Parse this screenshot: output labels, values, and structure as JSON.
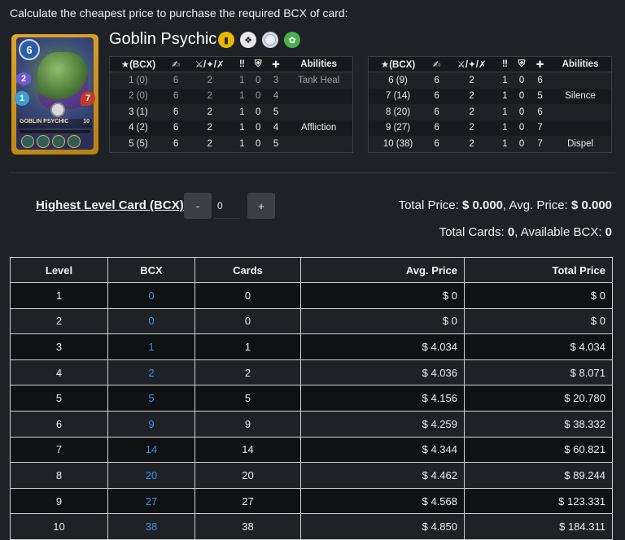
{
  "instruction": "Calculate the cheapest price to purchase the required BCX of card:",
  "card": {
    "name": "Goblin Psychic",
    "art_name": "GOBLIN PSYCHIC",
    "art_mana": "6",
    "art_level": "2",
    "art_speed": "1",
    "art_health": "7",
    "art_level_small": "10",
    "icons": [
      "rarity-icon",
      "edition-icon",
      "type-icon",
      "element-icon"
    ]
  },
  "stat_headers": {
    "level": "★(BCX)",
    "mana_icon": "mana-icon",
    "attack_icon": "attack-icon",
    "speed_icon": "speed-icon",
    "armor_icon": "armor-icon",
    "health_icon": "health-icon",
    "abilities": "Abilities"
  },
  "stats_left": [
    {
      "lvl": "1 (0)",
      "mana": "6",
      "atk": "2",
      "spd": "1",
      "arm": "0",
      "hp": "3",
      "abil": "Tank Heal",
      "dim": true
    },
    {
      "lvl": "2 (0)",
      "mana": "6",
      "atk": "2",
      "spd": "1",
      "arm": "0",
      "hp": "4",
      "abil": "",
      "dim": true
    },
    {
      "lvl": "3 (1)",
      "mana": "6",
      "atk": "2",
      "spd": "1",
      "arm": "0",
      "hp": "5",
      "abil": "",
      "dim": false
    },
    {
      "lvl": "4 (2)",
      "mana": "6",
      "atk": "2",
      "spd": "1",
      "arm": "0",
      "hp": "4",
      "abil": "Affliction",
      "dim": false
    },
    {
      "lvl": "5 (5)",
      "mana": "6",
      "atk": "2",
      "spd": "1",
      "arm": "0",
      "hp": "5",
      "abil": "",
      "dim": false
    }
  ],
  "stats_right": [
    {
      "lvl": "6 (9)",
      "mana": "6",
      "atk": "2",
      "spd": "1",
      "arm": "0",
      "hp": "6",
      "abil": ""
    },
    {
      "lvl": "7 (14)",
      "mana": "6",
      "atk": "2",
      "spd": "1",
      "arm": "0",
      "hp": "5",
      "abil": "Silence"
    },
    {
      "lvl": "8 (20)",
      "mana": "6",
      "atk": "2",
      "spd": "1",
      "arm": "0",
      "hp": "6",
      "abil": ""
    },
    {
      "lvl": "9 (27)",
      "mana": "6",
      "atk": "2",
      "spd": "1",
      "arm": "0",
      "hp": "7",
      "abil": ""
    },
    {
      "lvl": "10 (38)",
      "mana": "6",
      "atk": "2",
      "spd": "1",
      "arm": "0",
      "hp": "7",
      "abil": "Dispel"
    }
  ],
  "controls": {
    "label": "Highest Level Card (BCX)",
    "minus": "-",
    "plus": "+",
    "value": "0"
  },
  "summary": {
    "total_price_label": "Total Price: ",
    "total_price": "$ 0.000",
    "avg_price_label": ", Avg. Price: ",
    "avg_price": "$ 0.000",
    "total_cards_label": "Total Cards: ",
    "total_cards": "0",
    "available_bcx_label": ", Available BCX: ",
    "available_bcx": "0"
  },
  "table": {
    "headers": [
      "Level",
      "BCX",
      "Cards",
      "Avg. Price",
      "Total Price"
    ],
    "rows": [
      [
        "1",
        "0",
        "0",
        "$ 0",
        "$ 0"
      ],
      [
        "2",
        "0",
        "0",
        "$ 0",
        "$ 0"
      ],
      [
        "3",
        "1",
        "1",
        "$ 4.034",
        "$ 4.034"
      ],
      [
        "4",
        "2",
        "2",
        "$ 4.036",
        "$ 8.071"
      ],
      [
        "5",
        "5",
        "5",
        "$ 4.156",
        "$ 20.780"
      ],
      [
        "6",
        "9",
        "9",
        "$ 4.259",
        "$ 38.332"
      ],
      [
        "7",
        "14",
        "14",
        "$ 4.344",
        "$ 60.821"
      ],
      [
        "8",
        "20",
        "20",
        "$ 4.462",
        "$ 89.244"
      ],
      [
        "9",
        "27",
        "27",
        "$ 4.568",
        "$ 123.331"
      ],
      [
        "10",
        "38",
        "38",
        "$ 4.850",
        "$ 184.311"
      ]
    ]
  },
  "colors": {
    "background": "#1e2226",
    "bcx_link": "#3d8fe6",
    "button": "#3a4048"
  }
}
